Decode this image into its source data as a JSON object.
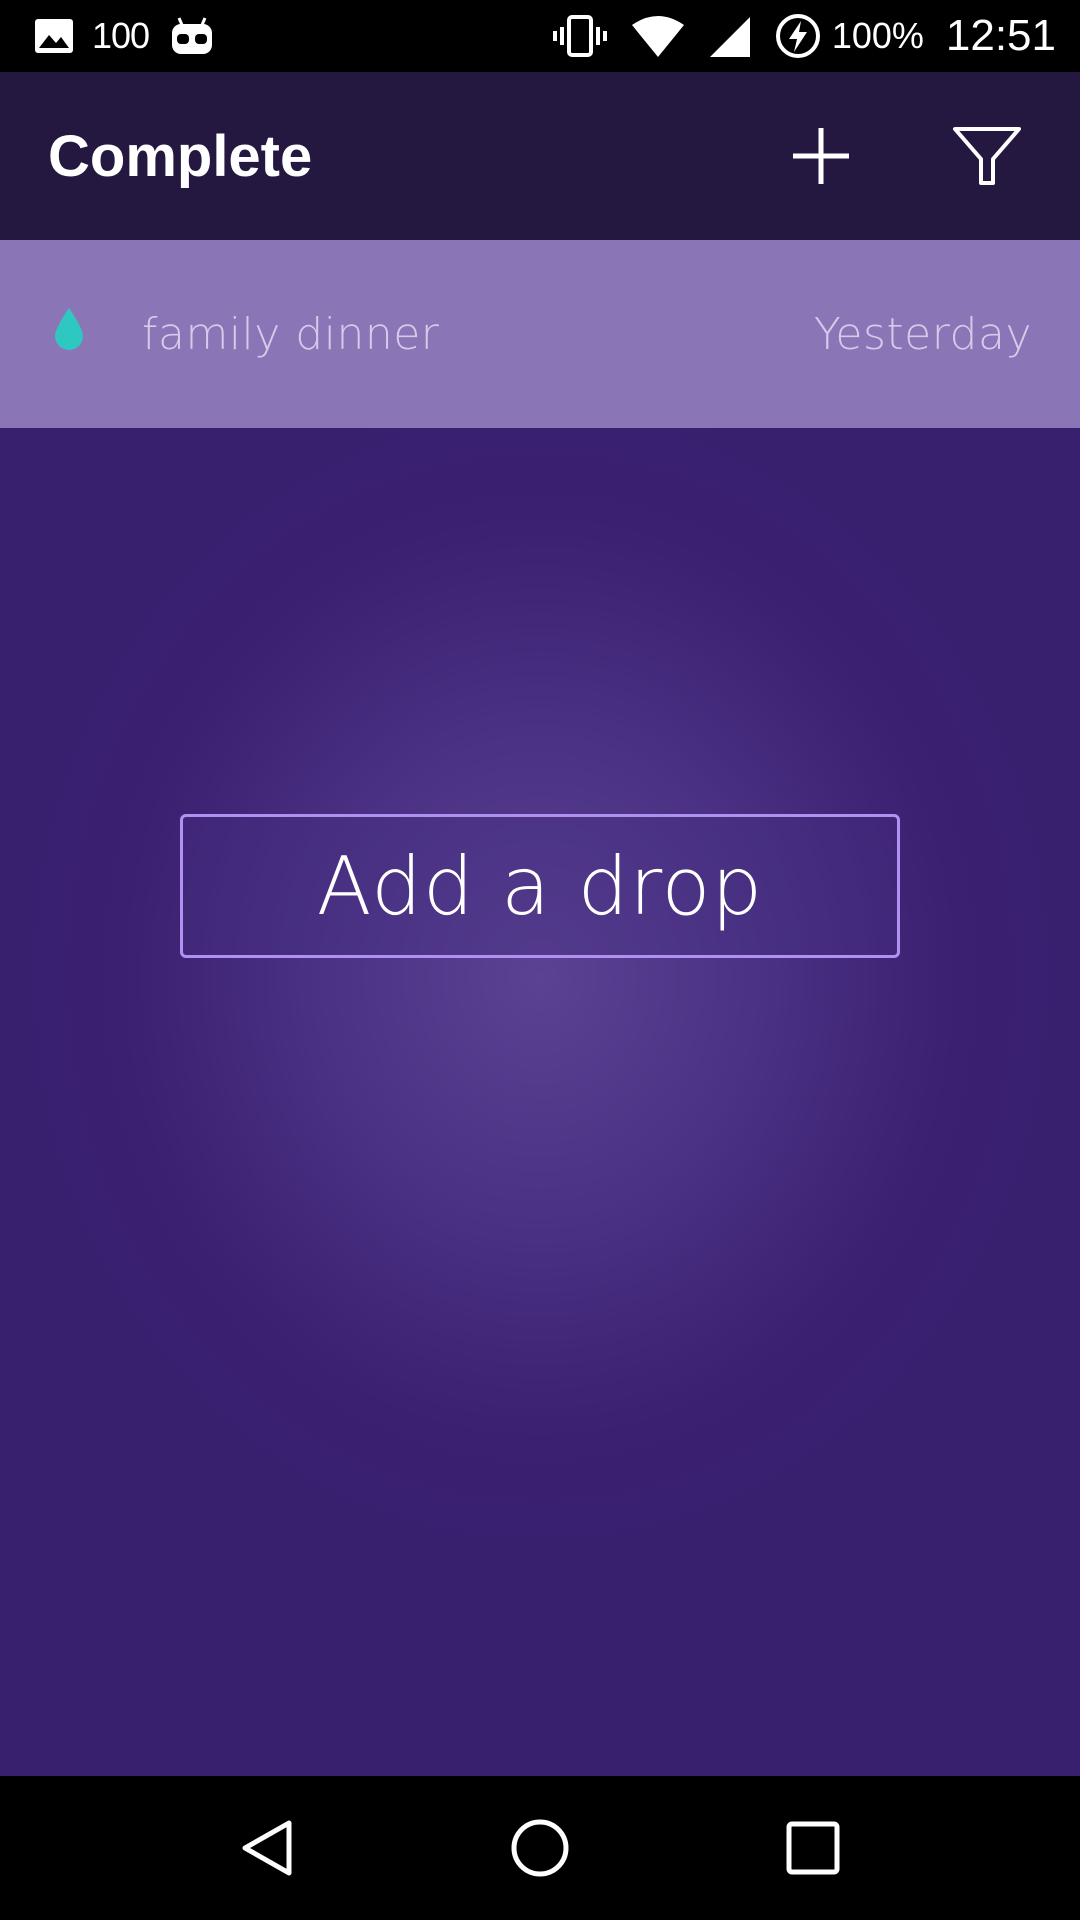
{
  "status_bar": {
    "notification_count": "100",
    "battery_percent": "100%",
    "time": "12:51",
    "icons": [
      "image-icon",
      "cyanogen-robot-icon",
      "vibrate-icon",
      "wifi-icon",
      "signal-icon",
      "battery-charging-icon"
    ]
  },
  "app_bar": {
    "title": "Complete",
    "actions": [
      "add-icon",
      "filter-icon"
    ]
  },
  "list": {
    "items": [
      {
        "title": "family dinner",
        "date": "Yesterday",
        "icon": "drop-icon",
        "icon_color": "#2fc8c1"
      }
    ]
  },
  "empty_action": {
    "label": "Add a drop"
  },
  "nav_bar": {
    "buttons": [
      "back-icon",
      "home-icon",
      "recents-icon"
    ]
  },
  "colors": {
    "app_bar": "#241840",
    "background": "#3b1f70",
    "row": "#8a76b6",
    "button_border": "#b091f2",
    "accent_drop": "#2fc8c1"
  }
}
